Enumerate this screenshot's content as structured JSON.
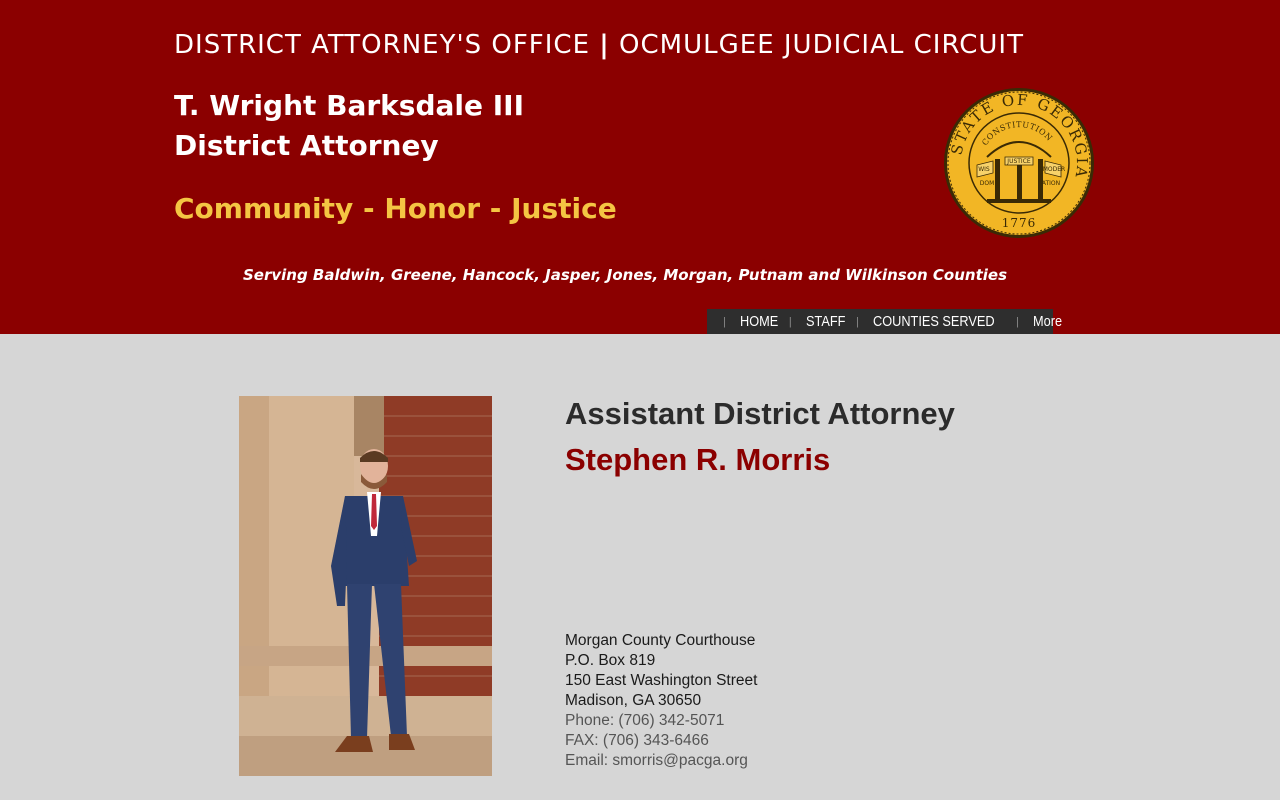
{
  "header": {
    "office_left": "DISTRICT ATTORNEY'S OFFICE",
    "office_sep": "|",
    "office_right": "OCMULGEE JUDICIAL CIRCUIT",
    "da_name": "T. Wright Barksdale III",
    "da_title": "District Attorney",
    "motto": "Community - Honor - Justice",
    "serving": "Serving Baldwin, Greene, Hancock, Jasper, Jones, Morgan, Putnam and Wilkinson Counties"
  },
  "seal": {
    "ring_text": "STATE OF GEORGIA",
    "arch_text": "CONSTITUTION",
    "banner_left": "WIS",
    "banner_left2": "DOM",
    "banner_center": "JUSTICE",
    "banner_right": "MODER",
    "banner_right2": "ATION",
    "year": "1776",
    "colors": {
      "gold": "#f2b625",
      "dark": "#3a2a05"
    }
  },
  "nav": {
    "items": [
      "HOME",
      "STAFF",
      "COUNTIES SERVED",
      "More"
    ],
    "separator": "|"
  },
  "profile": {
    "role": "Assistant District Attorney",
    "name": "Stephen R. Morris",
    "address_lines": [
      "Morgan County Courthouse",
      "P.O. Box 819",
      "150 East Washington Street",
      "Madison, GA 30650"
    ],
    "phone": "Phone:  (706) 342-5071",
    "fax": "FAX:  (706) 343-6466",
    "email_label": "Email: ",
    "email": "smorris@pacga.org"
  },
  "colors": {
    "header_bg": "#8b0000",
    "motto": "#f4c543",
    "page_bg": "#d6d6d6",
    "nav_bg": "#2e2e2e"
  }
}
